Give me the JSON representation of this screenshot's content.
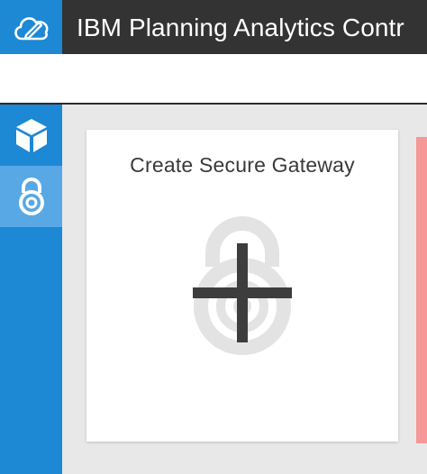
{
  "header": {
    "app_title": "IBM Planning Analytics Contr",
    "logo_icon": "cloud-edit-icon"
  },
  "sidebar": {
    "items": [
      {
        "icon": "cube-icon",
        "active": false
      },
      {
        "icon": "lock-icon",
        "active": true
      }
    ]
  },
  "main": {
    "card": {
      "title": "Create Secure Gateway",
      "icon": "lock-add-icon"
    }
  },
  "colors": {
    "brand_blue": "#1d88d4",
    "active_blue": "#57a8e5",
    "topbar_dark": "#333333",
    "peek_card_red": "#f59897"
  }
}
